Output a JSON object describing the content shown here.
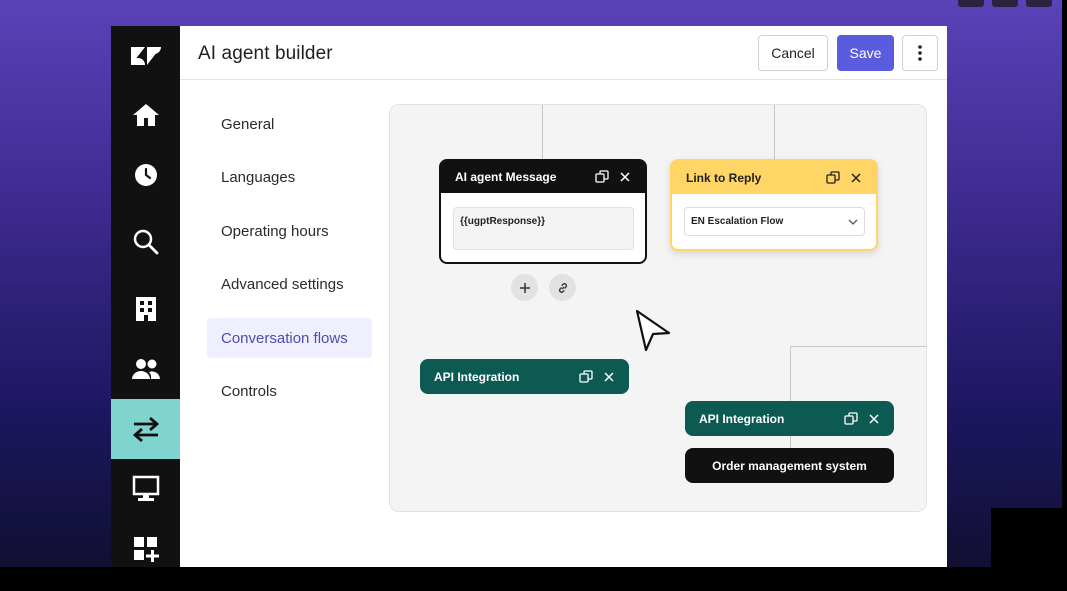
{
  "app": {
    "title": "AI agent builder"
  },
  "header": {
    "cancel_label": "Cancel",
    "save_label": "Save",
    "more_icon": "vertical-ellipsis-icon"
  },
  "rail": {
    "items": [
      {
        "name": "zendesk-logo",
        "icon": "zendesk-logo"
      },
      {
        "name": "home",
        "icon": "home-icon"
      },
      {
        "name": "recent",
        "icon": "clock-icon"
      },
      {
        "name": "search",
        "icon": "search-icon"
      },
      {
        "name": "organizations",
        "icon": "building-icon"
      },
      {
        "name": "customers",
        "icon": "users-icon"
      },
      {
        "name": "conversation-flows",
        "icon": "transfer-arrows-icon",
        "active": true
      },
      {
        "name": "workspace",
        "icon": "monitor-icon"
      },
      {
        "name": "add-apps",
        "icon": "apps-add-icon"
      }
    ]
  },
  "nav": {
    "items": [
      {
        "label": "General"
      },
      {
        "label": "Languages"
      },
      {
        "label": "Operating hours"
      },
      {
        "label": "Advanced settings"
      },
      {
        "label": "Conversation flows",
        "active": true
      },
      {
        "label": "Controls"
      }
    ]
  },
  "canvas": {
    "message_node": {
      "title": "AI agent Message",
      "value": "{{ugptResponse}}"
    },
    "link_node": {
      "title": "Link to Reply",
      "selected": "EN Escalation Flow"
    },
    "api_node_1": {
      "title": "API Integration"
    },
    "api_node_2": {
      "title": "API Integration"
    },
    "system_node": {
      "label": "Order management system"
    }
  },
  "colors": {
    "accent": "#5a5ce0",
    "rail_active": "#7fd4d0",
    "api_node": "#0c5a52",
    "link_node": "#ffd666",
    "nav_active_bg": "#f0efff",
    "nav_active_text": "#4c4ea8"
  }
}
